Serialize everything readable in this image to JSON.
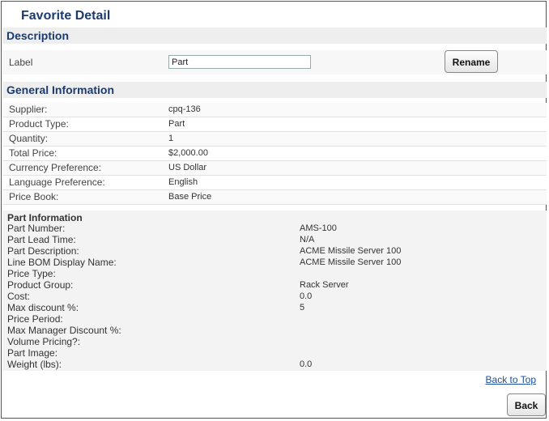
{
  "page": {
    "title": "Favorite Detail"
  },
  "description": {
    "header": "Description",
    "label": "Label",
    "input_value": "Part",
    "rename_label": "Rename"
  },
  "general": {
    "header": "General Information",
    "rows": [
      {
        "label": "Supplier:",
        "value": "cpq-136"
      },
      {
        "label": "Product Type:",
        "value": "Part"
      },
      {
        "label": "Quantity:",
        "value": "1"
      },
      {
        "label": "Total Price:",
        "value": "$2,000.00"
      },
      {
        "label": "Currency Preference:",
        "value": "US Dollar"
      },
      {
        "label": "Language Preference:",
        "value": "English"
      },
      {
        "label": "Price Book:",
        "value": "Base Price"
      }
    ]
  },
  "part": {
    "header": "Part Information",
    "rows": [
      {
        "label": "Part Number:",
        "value": "AMS-100"
      },
      {
        "label": "Part Lead Time:",
        "value": "N/A"
      },
      {
        "label": "Part Description:",
        "value": "ACME Missile Server 100"
      },
      {
        "label": "Line BOM Display Name:",
        "value": "ACME Missile Server 100"
      },
      {
        "label": "Price Type:",
        "value": ""
      },
      {
        "label": "Product Group:",
        "value": "Rack Server"
      },
      {
        "label": "Cost:",
        "value": "0.0"
      },
      {
        "label": "Max discount %:",
        "value": "5"
      },
      {
        "label": "Price Period:",
        "value": ""
      },
      {
        "label": "Max Manager Discount %:",
        "value": ""
      },
      {
        "label": "Volume Pricing?:",
        "value": ""
      },
      {
        "label": "Part Image:",
        "value": ""
      },
      {
        "label": "Weight (lbs):",
        "value": "0.0"
      }
    ]
  },
  "footer": {
    "back_to_top": "Back to Top",
    "back_label": "Back"
  }
}
